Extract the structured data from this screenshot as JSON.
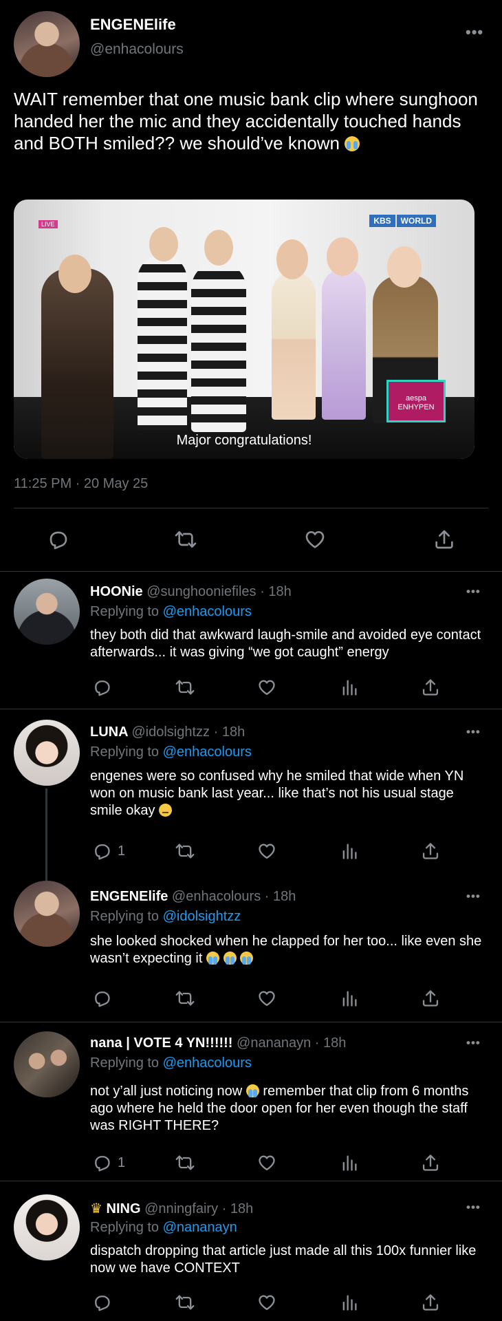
{
  "main_tweet": {
    "name": "ENGENElife",
    "handle": "@enhacolours",
    "text": "WAIT remember that one music bank clip where sunghoon handed her the mic and they accidentally touched hands and BOTH smiled?? we should’ve known",
    "media": {
      "caption": "Major congratulations!",
      "channel_label": "KBS",
      "channel_label_2": "WORLD",
      "live_label": "LIVE",
      "box_line1": "aespa",
      "box_line2": "ENHYPEN"
    },
    "timestamp": "11:25 PM · 20 May 25"
  },
  "icons": [
    "more-icon",
    "reply-icon",
    "retweet-icon",
    "like-icon",
    "views-icon",
    "share-icon"
  ],
  "replies": [
    {
      "name": "HOONie",
      "handle": "@sunghooniefiles",
      "time": "18h",
      "replying_label": "Replying to",
      "replying_to": "@enhacolours",
      "text": "they both did that awkward laugh-smile and avoided eye contact afterwards... it was giving “we got caught” energy",
      "reply_count": ""
    },
    {
      "name": "LUNA",
      "handle": "@idolsightzz",
      "time": "18h",
      "replying_label": "Replying to",
      "replying_to": "@enhacolours",
      "text": "engenes were so confused why he smiled that wide when YN won on music bank last year... like that’s not his usual stage smile okay",
      "reply_count": "1"
    },
    {
      "name": "ENGENElife",
      "handle": "@enhacolours",
      "time": "18h",
      "replying_label": "Replying to",
      "replying_to": "@idolsightzz",
      "text": "she looked shocked when he clapped for her too... like even she wasn’t expecting it",
      "reply_count": ""
    },
    {
      "name": "nana | VOTE 4 YN!!!!!!",
      "handle": "@nananayn",
      "time": "18h",
      "replying_label": "Replying to",
      "replying_to": "@enhacolours",
      "text_a": "not y’all just noticing now",
      "text_b": "remember that clip from 6 months ago where he held the door open for her even though the staff was RIGHT THERE?",
      "reply_count": "1"
    },
    {
      "name": "NING",
      "handle": "@nningfairy",
      "time": "18h",
      "replying_label": "Replying to",
      "replying_to": "@nananayn",
      "text": "dispatch dropping that article just made all this 100x funnier like now we have CONTEXT",
      "reply_count": ""
    }
  ],
  "separator": "·",
  "more_glyph": "•••"
}
